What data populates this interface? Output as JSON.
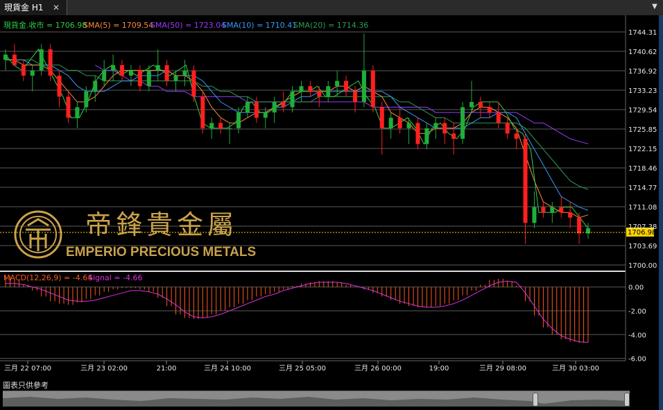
{
  "tab": {
    "label": "現貨金 H1",
    "close": "✕",
    "menu": "▼"
  },
  "disclaimer": "圖表只供參考",
  "watermark": {
    "cn": "帝鋒貴金屬",
    "en": "EMPERIO PRECIOUS METALS"
  },
  "colors": {
    "bg": "#000000",
    "grid": "#5a5a5a",
    "up": "#1fae3a",
    "down": "#ff1f1f",
    "close": "#2fd04a",
    "sma5": "#ff8a3a",
    "sma50": "#9b3bff",
    "sma10": "#3a9aff",
    "sma20": "#2f9b55",
    "macd": "#ff5a1f",
    "signal": "#e030e0",
    "last": "#ffd200",
    "axis_text": "#e8e8e8",
    "gold": "#c9a24a"
  },
  "legend": {
    "close": "現貨金.收市 = 1706.98",
    "sma5": "SMA(5) = 1709.54",
    "sma50": "SMA(50) = 1723.04",
    "sma10": "SMA(10) = 1710.41",
    "sma20": "SMA(20) = 1714.36"
  },
  "macd_legend": {
    "macd": "MACD(12,26,9) = -4.64",
    "signal": "Signal = -4.66"
  },
  "price_ticks": [
    "1744.31",
    "1740.62",
    "1736.92",
    "1733.23",
    "1729.54",
    "1725.85",
    "1722.15",
    "1718.46",
    "1714.77",
    "1711.08",
    "1707.38",
    "1703.69",
    "1700.00"
  ],
  "last_price": "1706.98",
  "macd_ticks": [
    "0.00",
    "-2.00",
    "-4.00",
    "-6.00"
  ],
  "time_labels": [
    "三月 22 07:00",
    "三月 23 02:00",
    "21:00",
    "三月 24 10:00",
    "三月 25 05:00",
    "三月 26 00:00",
    "19:00",
    "三月 29 08:00",
    "三月 30 03:00"
  ],
  "chart_data": {
    "type": "candlestick",
    "title": "現貨金 H1",
    "price_axis": {
      "min": 1700.0,
      "max": 1744.31,
      "ticks": [
        1744.31,
        1740.62,
        1736.92,
        1733.23,
        1729.54,
        1725.85,
        1722.15,
        1718.46,
        1714.77,
        1711.08,
        1707.38,
        1703.69,
        1700.0
      ]
    },
    "x_labels": [
      "三月 22 07:00",
      "三月 23 02:00",
      "21:00",
      "三月 24 10:00",
      "三月 25 05:00",
      "三月 26 00:00",
      "19:00",
      "三月 29 08:00",
      "三月 30 03:00"
    ],
    "close_path": [
      1740,
      1738,
      1737,
      1739,
      1741,
      1738,
      1735,
      1732,
      1728,
      1728,
      1731,
      1735,
      1737,
      1738,
      1736,
      1737,
      1736,
      1737,
      1738,
      1737,
      1736,
      1737,
      1738,
      1732,
      1727,
      1726,
      1726,
      1726,
      1727,
      1730,
      1731,
      1729,
      1729,
      1730,
      1731,
      1733,
      1733,
      1733,
      1734,
      1732,
      1732,
      1733,
      1734,
      1735,
      1732,
      1730,
      1726,
      1726,
      1727,
      1728,
      1726,
      1723,
      1726,
      1727,
      1725,
      1724,
      1726,
      1730,
      1731,
      1731,
      1731,
      1729,
      1726,
      1725,
      1722,
      1710,
      1710,
      1710,
      1711,
      1711,
      1709,
      1706.98
    ],
    "candles": [
      [
        1739,
        1741,
        1737,
        1740
      ],
      [
        1740,
        1742,
        1738,
        1738
      ],
      [
        1738,
        1739,
        1735,
        1736
      ],
      [
        1736,
        1738,
        1733,
        1737
      ],
      [
        1737,
        1742,
        1736,
        1741
      ],
      [
        1741,
        1742,
        1735,
        1736
      ],
      [
        1736,
        1737,
        1730,
        1732
      ],
      [
        1732,
        1733,
        1727,
        1728
      ],
      [
        1728,
        1731,
        1726,
        1730
      ],
      [
        1730,
        1734,
        1729,
        1733
      ],
      [
        1733,
        1736,
        1731,
        1735
      ],
      [
        1735,
        1739,
        1734,
        1737
      ],
      [
        1737,
        1740,
        1735,
        1738
      ],
      [
        1738,
        1739,
        1735,
        1736
      ],
      [
        1736,
        1738,
        1734,
        1737
      ],
      [
        1737,
        1738,
        1733,
        1734
      ],
      [
        1734,
        1738,
        1733,
        1737
      ],
      [
        1737,
        1741,
        1735,
        1738
      ],
      [
        1738,
        1739,
        1734,
        1735
      ],
      [
        1735,
        1737,
        1733,
        1736
      ],
      [
        1736,
        1739,
        1734,
        1737
      ],
      [
        1737,
        1738,
        1731,
        1732
      ],
      [
        1732,
        1733,
        1725,
        1726
      ],
      [
        1726,
        1728,
        1724,
        1727
      ],
      [
        1727,
        1728,
        1725,
        1726
      ],
      [
        1726,
        1727,
        1723,
        1726
      ],
      [
        1726,
        1730,
        1725,
        1729
      ],
      [
        1729,
        1732,
        1728,
        1731
      ],
      [
        1731,
        1732,
        1727,
        1728
      ],
      [
        1728,
        1730,
        1726,
        1729
      ],
      [
        1729,
        1732,
        1727,
        1731
      ],
      [
        1731,
        1733,
        1729,
        1730
      ],
      [
        1730,
        1734,
        1729,
        1733
      ],
      [
        1733,
        1735,
        1731,
        1734
      ],
      [
        1734,
        1735,
        1732,
        1733
      ],
      [
        1733,
        1734,
        1730,
        1732
      ],
      [
        1732,
        1735,
        1731,
        1734
      ],
      [
        1734,
        1737,
        1732,
        1735
      ],
      [
        1735,
        1736,
        1732,
        1733
      ],
      [
        1733,
        1734,
        1729,
        1731
      ],
      [
        1731,
        1744,
        1730,
        1737
      ],
      [
        1737,
        1738,
        1729,
        1730
      ],
      [
        1730,
        1731,
        1721,
        1726
      ],
      [
        1726,
        1729,
        1724,
        1728
      ],
      [
        1728,
        1730,
        1725,
        1726
      ],
      [
        1726,
        1728,
        1723,
        1727
      ],
      [
        1727,
        1728,
        1722,
        1723
      ],
      [
        1723,
        1727,
        1722,
        1726
      ],
      [
        1726,
        1728,
        1724,
        1727
      ],
      [
        1727,
        1728,
        1723,
        1725
      ],
      [
        1725,
        1727,
        1721,
        1724
      ],
      [
        1724,
        1731,
        1723,
        1730
      ],
      [
        1730,
        1735,
        1729,
        1731
      ],
      [
        1731,
        1732,
        1728,
        1730
      ],
      [
        1730,
        1731,
        1728,
        1729
      ],
      [
        1729,
        1731,
        1726,
        1727
      ],
      [
        1727,
        1728,
        1724,
        1725
      ],
      [
        1725,
        1726,
        1722,
        1724
      ],
      [
        1724,
        1725,
        1704,
        1708
      ],
      [
        1708,
        1714,
        1707,
        1711
      ],
      [
        1711,
        1712,
        1709,
        1710
      ],
      [
        1710,
        1712,
        1708,
        1711
      ],
      [
        1711,
        1713,
        1709,
        1710
      ],
      [
        1710,
        1712,
        1707,
        1709
      ],
      [
        1709,
        1710,
        1704,
        1706
      ],
      [
        1706,
        1708,
        1705,
        1706.98
      ]
    ],
    "sma5": [
      1739,
      1739,
      1738,
      1738,
      1738,
      1737,
      1735,
      1733,
      1731,
      1731,
      1732,
      1734,
      1736,
      1737,
      1737,
      1737,
      1737,
      1737,
      1737,
      1736,
      1736,
      1735,
      1733,
      1730,
      1728,
      1727,
      1727,
      1728,
      1729,
      1729,
      1730,
      1731,
      1732,
      1733,
      1733,
      1733,
      1733,
      1734,
      1734,
      1733,
      1734,
      1733,
      1732,
      1729,
      1728,
      1727,
      1725,
      1725,
      1726,
      1726,
      1726,
      1727,
      1729,
      1730,
      1730,
      1729,
      1728,
      1726,
      1721,
      1716,
      1712,
      1711,
      1710,
      1710,
      1709,
      1709.54
    ],
    "sma10": [
      1739,
      1739,
      1739,
      1738,
      1738,
      1738,
      1737,
      1736,
      1734,
      1733,
      1733,
      1733,
      1734,
      1735,
      1735,
      1736,
      1736,
      1736,
      1737,
      1736,
      1736,
      1736,
      1735,
      1733,
      1731,
      1730,
      1729,
      1729,
      1729,
      1729,
      1730,
      1730,
      1731,
      1732,
      1732,
      1733,
      1733,
      1733,
      1733,
      1733,
      1733,
      1733,
      1733,
      1732,
      1730,
      1729,
      1728,
      1727,
      1726,
      1726,
      1726,
      1726,
      1727,
      1728,
      1728,
      1729,
      1729,
      1728,
      1725,
      1722,
      1719,
      1716,
      1713,
      1712,
      1711,
      1710.41
    ],
    "sma20": [
      1739,
      1739,
      1739,
      1739,
      1738,
      1738,
      1738,
      1737,
      1737,
      1736,
      1736,
      1735,
      1735,
      1735,
      1735,
      1735,
      1735,
      1735,
      1735,
      1735,
      1735,
      1735,
      1734,
      1734,
      1733,
      1733,
      1732,
      1732,
      1731,
      1731,
      1731,
      1731,
      1731,
      1731,
      1731,
      1732,
      1732,
      1732,
      1732,
      1732,
      1732,
      1732,
      1732,
      1732,
      1731,
      1731,
      1730,
      1729,
      1728,
      1728,
      1727,
      1727,
      1727,
      1727,
      1727,
      1727,
      1727,
      1727,
      1726,
      1724,
      1722,
      1720,
      1718,
      1716,
      1715,
      1714.36
    ],
    "sma50": [
      null,
      null,
      null,
      null,
      null,
      null,
      null,
      null,
      null,
      null,
      1738,
      1737,
      1737,
      1736,
      1735,
      1735,
      1734,
      1734,
      1733,
      1733,
      1733,
      1732,
      1732,
      1732,
      1732,
      1732,
      1732,
      1731,
      1731,
      1731,
      1731,
      1731,
      1731,
      1731,
      1731,
      1731,
      1731,
      1731,
      1731,
      1731,
      1731,
      1730,
      1730,
      1730,
      1730,
      1730,
      1730,
      1730,
      1729,
      1729,
      1729,
      1729,
      1729,
      1729,
      1729,
      1729,
      1729,
      1729,
      1728,
      1727,
      1727,
      1726,
      1725,
      1724,
      1723.5,
      1723.04
    ],
    "macd": [
      0.9,
      0.6,
      0.2,
      -0.3,
      -0.8,
      -1.2,
      -1.4,
      -1.5,
      -1.3,
      -1.0,
      -0.7,
      -0.4,
      -0.2,
      -0.1,
      -0.1,
      -0.2,
      -0.4,
      -0.9,
      -1.6,
      -2.3,
      -2.6,
      -2.7,
      -2.6,
      -2.3,
      -2.0,
      -1.7,
      -1.4,
      -1.1,
      -0.8,
      -0.6,
      -0.4,
      -0.2,
      0.1,
      0.3,
      0.4,
      0.5,
      0.5,
      0.4,
      0.2,
      0.0,
      -0.2,
      -0.5,
      -0.8,
      -1.1,
      -1.4,
      -1.6,
      -1.7,
      -1.7,
      -1.6,
      -1.4,
      -1.1,
      -0.7,
      -0.3,
      0.2,
      0.6,
      0.7,
      0.5,
      0.1,
      -1.2,
      -2.4,
      -3.4,
      -4.0,
      -4.4,
      -4.6,
      -4.7,
      -4.64
    ],
    "signal": [
      0.3,
      0.3,
      0.2,
      0.0,
      -0.2,
      -0.5,
      -0.8,
      -1.1,
      -1.2,
      -1.2,
      -1.1,
      -0.9,
      -0.7,
      -0.5,
      -0.3,
      -0.3,
      -0.4,
      -0.6,
      -1.0,
      -1.5,
      -2.1,
      -2.5,
      -2.6,
      -2.5,
      -2.3,
      -2.0,
      -1.7,
      -1.4,
      -1.1,
      -0.8,
      -0.6,
      -0.3,
      -0.1,
      0.1,
      0.3,
      0.4,
      0.4,
      0.4,
      0.3,
      0.1,
      -0.1,
      -0.3,
      -0.6,
      -0.9,
      -1.2,
      -1.4,
      -1.6,
      -1.7,
      -1.7,
      -1.6,
      -1.4,
      -1.1,
      -0.7,
      -0.3,
      0.1,
      0.4,
      0.5,
      0.4,
      -0.5,
      -1.6,
      -2.7,
      -3.5,
      -4.1,
      -4.4,
      -4.6,
      -4.66
    ],
    "macd_axis": {
      "min": -6.2,
      "max": 0.8,
      "ticks": [
        0.0,
        -2.0,
        -4.0,
        -6.0
      ]
    }
  }
}
